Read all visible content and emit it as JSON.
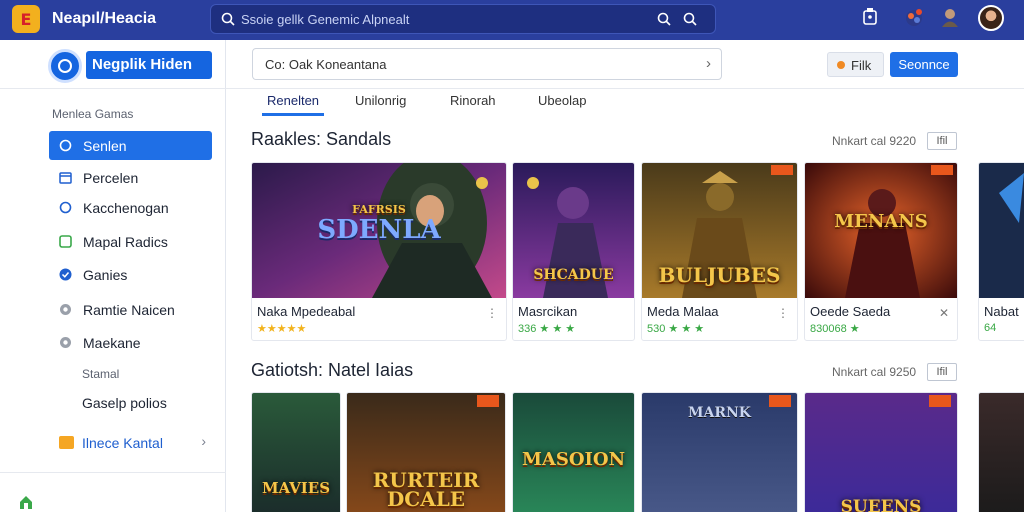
{
  "header": {
    "logo_glyph": "E",
    "title": "Neapıl/Heacia",
    "search_placeholder": "Ssoie gellk Genemic Alpnealt",
    "accent": "#2a3f9e"
  },
  "sidebar": {
    "brand": "Negplik Hiden",
    "section_title": "Menlea Gamas",
    "items": [
      {
        "label": "Senlen",
        "icon": "circle-icon",
        "active": true
      },
      {
        "label": "Percelen",
        "icon": "calendar-icon",
        "active": false
      },
      {
        "label": "Kacchenogan",
        "icon": "circle-icon",
        "active": false
      },
      {
        "label": "Mapal Radics",
        "icon": "square-icon",
        "active": false
      },
      {
        "label": "Ganies",
        "icon": "check-icon",
        "active": false
      },
      {
        "label": "Ramtie Naicen",
        "icon": "gear-icon",
        "active": false
      },
      {
        "label": "Maekane",
        "icon": "gear-icon",
        "active": false
      }
    ],
    "sub_label": "Stamal",
    "plain_item": "Gaselp polios",
    "link": "Ilnece Kantal"
  },
  "toolbar": {
    "search_value": "Co: Oak Koneantana",
    "filter_label": "Filk",
    "primary_label": "Seonnce"
  },
  "tabs": [
    "Renelten",
    "Unilonrig",
    "Rinorah",
    "Ubeolap"
  ],
  "sections": [
    {
      "title": "Raakles: Sandals",
      "meta": "Nnkart cal 9220",
      "meta_box": "Ifil",
      "cards": [
        {
          "name": "Naka Mpedeabal",
          "rating": "★★★★★",
          "art_text": "SDENLA",
          "art_top": "FAFRSIS"
        },
        {
          "name": "Masrcikan",
          "rating": "336 ★ ★ ★",
          "art_text": "SHCADUE",
          "art_top": ""
        },
        {
          "name": "Meda Malaa",
          "rating": "530 ★ ★ ★",
          "art_text": "BULJUBES",
          "art_top": ""
        },
        {
          "name": "Oeede Saeda",
          "rating": "830068 ★",
          "art_text": "MENANS",
          "art_top": ""
        },
        {
          "name": "Nabat",
          "rating": "64",
          "art_text": "",
          "art_top": ""
        }
      ]
    },
    {
      "title": "Gatiotsh: Natel Iaias",
      "meta": "Nnkart cal 9250",
      "meta_box": "Ifil",
      "cards": [
        {
          "art_text": "MAVIES"
        },
        {
          "art_text": "RURTEIR DCALE"
        },
        {
          "art_text": "MASOION"
        },
        {
          "art_text": "MARNK"
        },
        {
          "art_text": "SUEENS"
        },
        {
          "art_text": ""
        }
      ]
    }
  ]
}
